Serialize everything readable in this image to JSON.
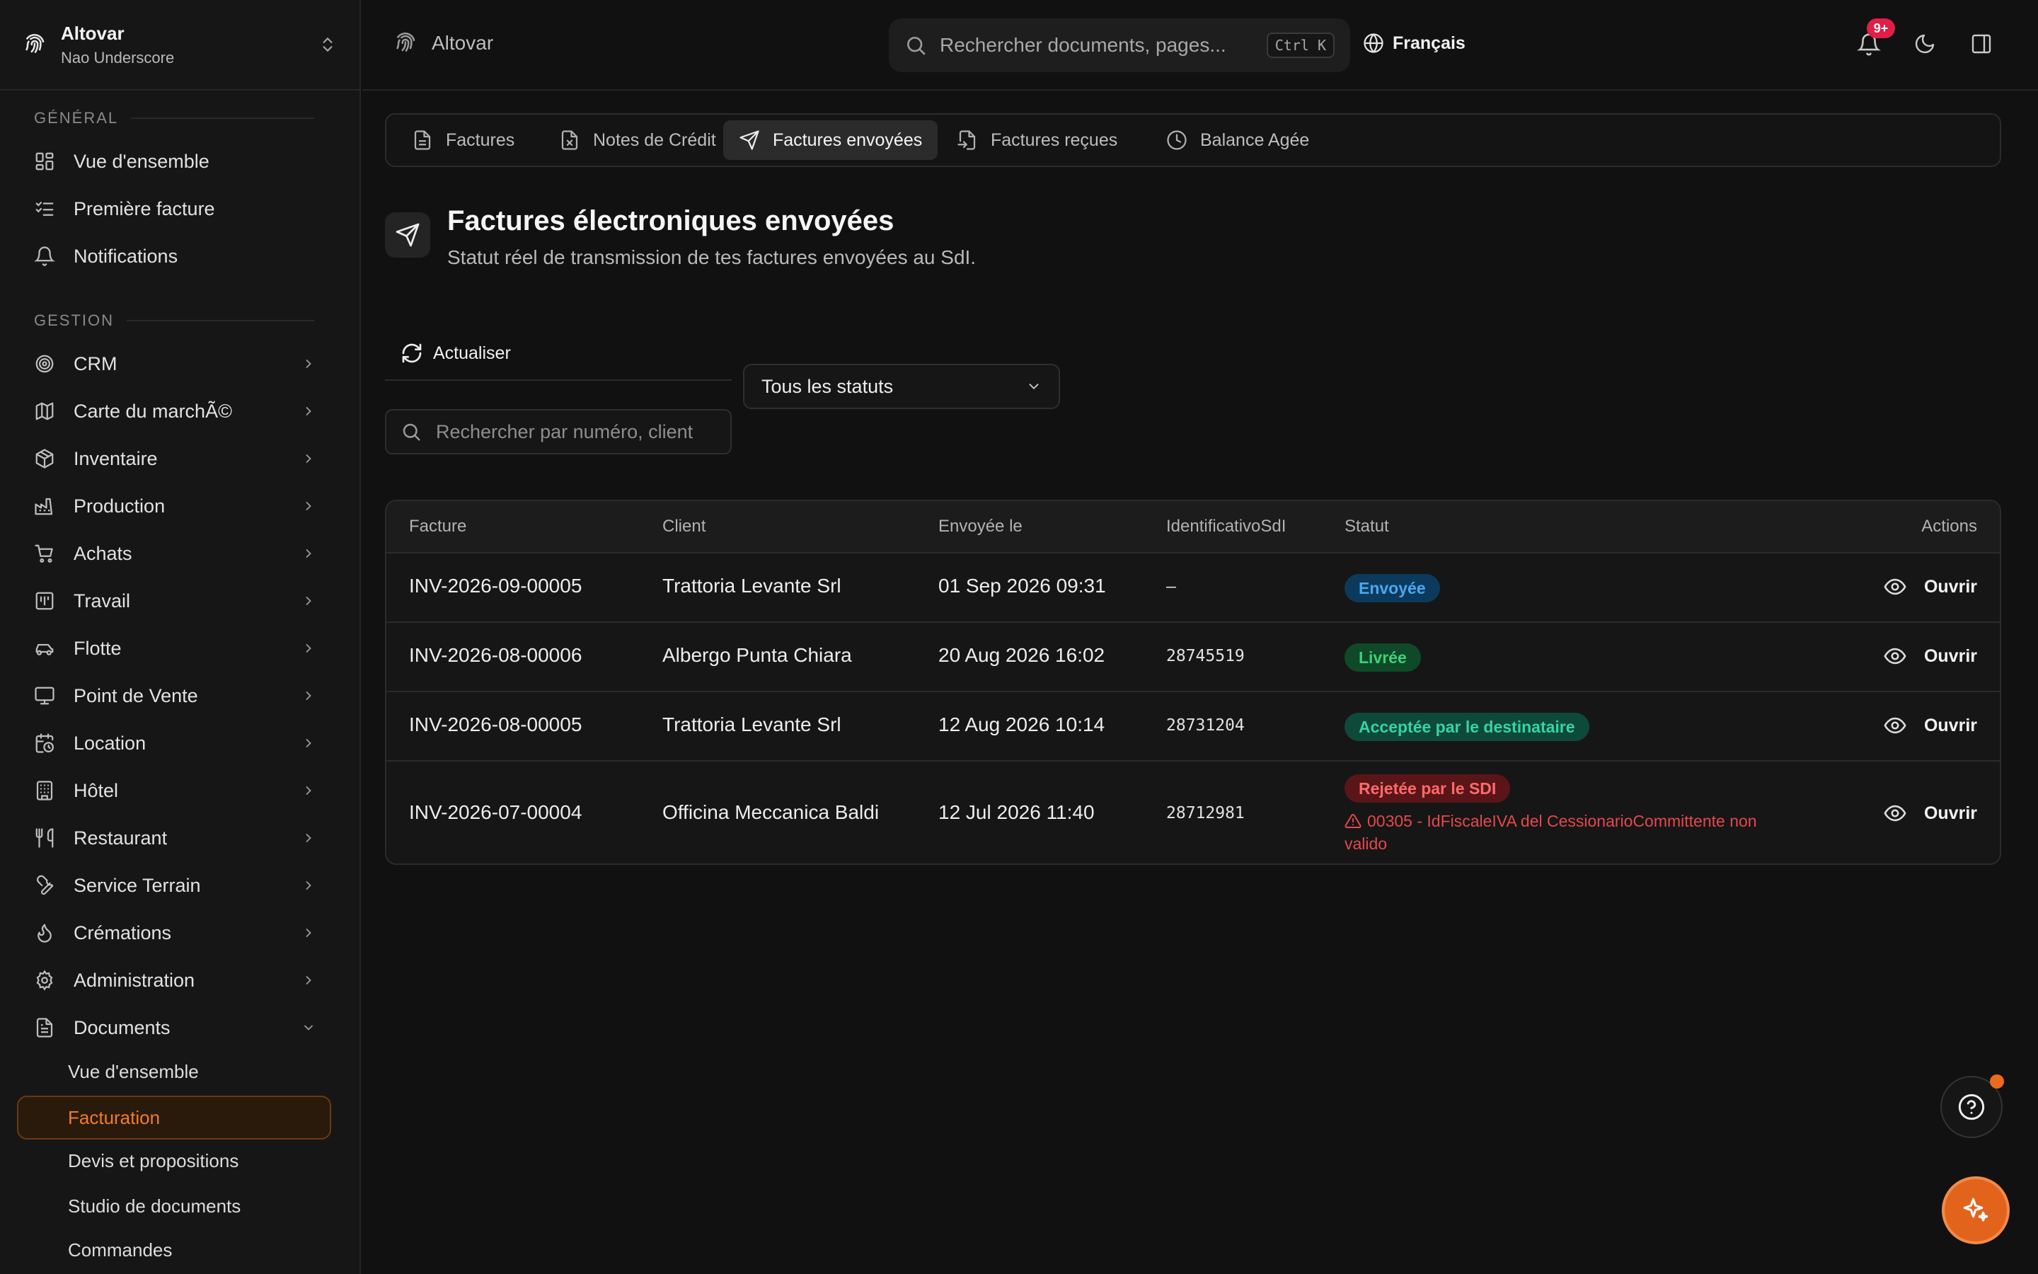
{
  "sidebar": {
    "org_name": "Altovar",
    "org_user": "Nao Underscore",
    "section_general": "GÉNÉRAL",
    "section_gestion": "GESTION",
    "general_items": [
      {
        "label": "Vue d'ensemble",
        "icon": "grid-icon"
      },
      {
        "label": "Première facture",
        "icon": "checklist-icon"
      },
      {
        "label": "Notifications",
        "icon": "bell-icon"
      }
    ],
    "gestion_items": [
      {
        "label": "CRM",
        "icon": "target-icon"
      },
      {
        "label": "Carte du marchÃ©",
        "icon": "map-icon"
      },
      {
        "label": "Inventaire",
        "icon": "box-icon"
      },
      {
        "label": "Production",
        "icon": "factory-icon"
      },
      {
        "label": "Achats",
        "icon": "cart-icon"
      },
      {
        "label": "Travail",
        "icon": "calendar-grid-icon"
      },
      {
        "label": "Flotte",
        "icon": "car-icon"
      },
      {
        "label": "Point de Vente",
        "icon": "monitor-icon"
      },
      {
        "label": "Location",
        "icon": "calendar-clock-icon"
      },
      {
        "label": "Hôtel",
        "icon": "building-icon"
      },
      {
        "label": "Restaurant",
        "icon": "utensils-icon"
      },
      {
        "label": "Service Terrain",
        "icon": "wrench-icon"
      },
      {
        "label": "Crémations",
        "icon": "flame-icon"
      },
      {
        "label": "Administration",
        "icon": "gear-icon"
      },
      {
        "label": "Documents",
        "icon": "document-icon"
      }
    ],
    "documents_sub": [
      "Vue d'ensemble",
      "Facturation",
      "Devis et propositions",
      "Studio de documents",
      "Commandes"
    ],
    "active_sub": "Facturation"
  },
  "topbar": {
    "brand": "Altovar",
    "search_placeholder": "Rechercher documents, pages...",
    "shortcut": "Ctrl K",
    "language": "Français",
    "notif_badge": "9+"
  },
  "tabs": [
    {
      "label": "Factures",
      "icon": "document-icon"
    },
    {
      "label": "Notes de Crédit",
      "icon": "document-x-icon"
    },
    {
      "label": "Factures envoyées",
      "icon": "send-icon",
      "active": true
    },
    {
      "label": "Factures reçues",
      "icon": "document-import-icon"
    },
    {
      "label": "Balance Agée",
      "icon": "clock-icon"
    }
  ],
  "page": {
    "title": "Factures électroniques envoyées",
    "subtitle": "Statut réel de transmission de tes factures envoyées au SdI."
  },
  "toolbar": {
    "refresh_label": "Actualiser",
    "status_filter": "Tous les statuts",
    "search_placeholder": "Rechercher par numéro, client"
  },
  "table": {
    "headers": [
      "Facture",
      "Client",
      "Envoyée le",
      "IdentificativoSdI",
      "Statut",
      "Actions"
    ],
    "open_label": "Ouvrir",
    "rows": [
      {
        "invoice": "INV-2026-09-00005",
        "client": "Trattoria Levante Srl",
        "sent": "01 Sep 2026 09:31",
        "sdi": "–",
        "status": "Envoyée",
        "status_kind": "sent"
      },
      {
        "invoice": "INV-2026-08-00006",
        "client": "Albergo Punta Chiara",
        "sent": "20 Aug 2026 16:02",
        "sdi": "28745519",
        "status": "Livrée",
        "status_kind": "delivered"
      },
      {
        "invoice": "INV-2026-08-00005",
        "client": "Trattoria Levante Srl",
        "sent": "12 Aug 2026 10:14",
        "sdi": "28731204",
        "status": "Acceptée par le destinataire",
        "status_kind": "accepted"
      },
      {
        "invoice": "INV-2026-07-00004",
        "client": "Officina Meccanica Baldi",
        "sent": "12 Jul 2026 11:40",
        "sdi": "28712981",
        "status": "Rejetée par le SDI",
        "status_kind": "rejected",
        "error": "00305 - IdFiscaleIVA del CessionarioCommittente non valido"
      }
    ]
  },
  "colors": {
    "accent": "#e2641c",
    "sent_bg": "#0c3a5c",
    "sent_fg": "#4aa8f0",
    "delivered_bg": "#0f4a28",
    "delivered_fg": "#3fd07a",
    "accepted_bg": "#0e4a3a",
    "accepted_fg": "#38d4a0",
    "rejected_bg": "#5a1518",
    "rejected_fg": "#ff6b6b"
  }
}
